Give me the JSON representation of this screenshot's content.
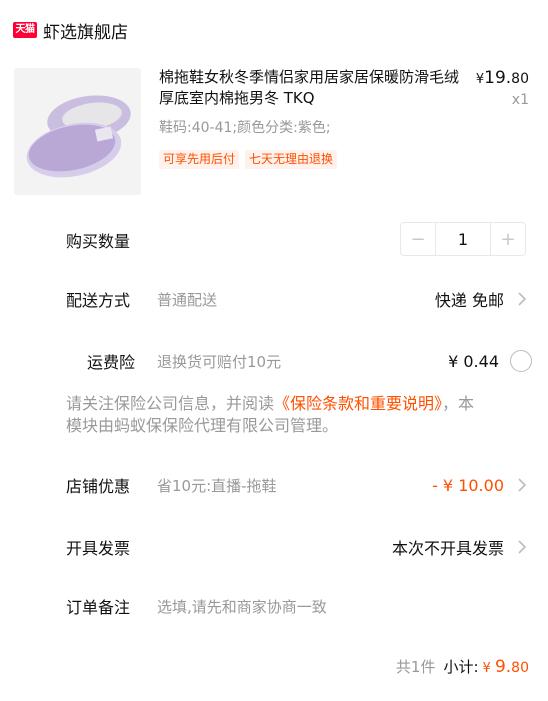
{
  "store": {
    "badge": "天猫",
    "name": "虾选旗舰店"
  },
  "product": {
    "title": "棉拖鞋女秋冬季情侣家用居家居保暖防滑毛绒厚底室内棉拖男冬 TKQ",
    "sku": "鞋码:40-41;颜色分类:紫色;",
    "tags": [
      "可享先用后付",
      "七天无理由退换"
    ],
    "price_symbol": "¥",
    "price_int": "19.",
    "price_dec": "80",
    "qty": "x1"
  },
  "rows": {
    "quantity": {
      "label": "购买数量",
      "value": "1",
      "minus": "−",
      "plus": "+"
    },
    "shipping": {
      "label": "配送方式",
      "value": "普通配送",
      "right": "快递 免邮"
    },
    "insurance": {
      "label": "运费险",
      "value": "退换货可赔付10元",
      "right": "¥ 0.44"
    },
    "notice_prefix": "请关注保险公司信息，并阅读",
    "notice_link": "《保险条款和重要说明》",
    "notice_suffix": "，本模块由蚂蚁保保险代理有限公司管理。",
    "coupon": {
      "label": "店铺优惠",
      "value": "省10元:直播-拖鞋",
      "right": "- ¥ 10.00"
    },
    "invoice": {
      "label": "开具发票",
      "right": "本次不开具发票"
    },
    "remark": {
      "label": "订单备注",
      "placeholder": "选填,请先和商家协商一致"
    }
  },
  "footer": {
    "count": "共1件",
    "subtotal_label": "小计:",
    "symbol": "¥ ",
    "total_int": "9.",
    "total_dec": "80"
  },
  "colors": {
    "accent": "#ff5000",
    "tmall": "#ff0036",
    "slipper": "#b9a8d6"
  }
}
